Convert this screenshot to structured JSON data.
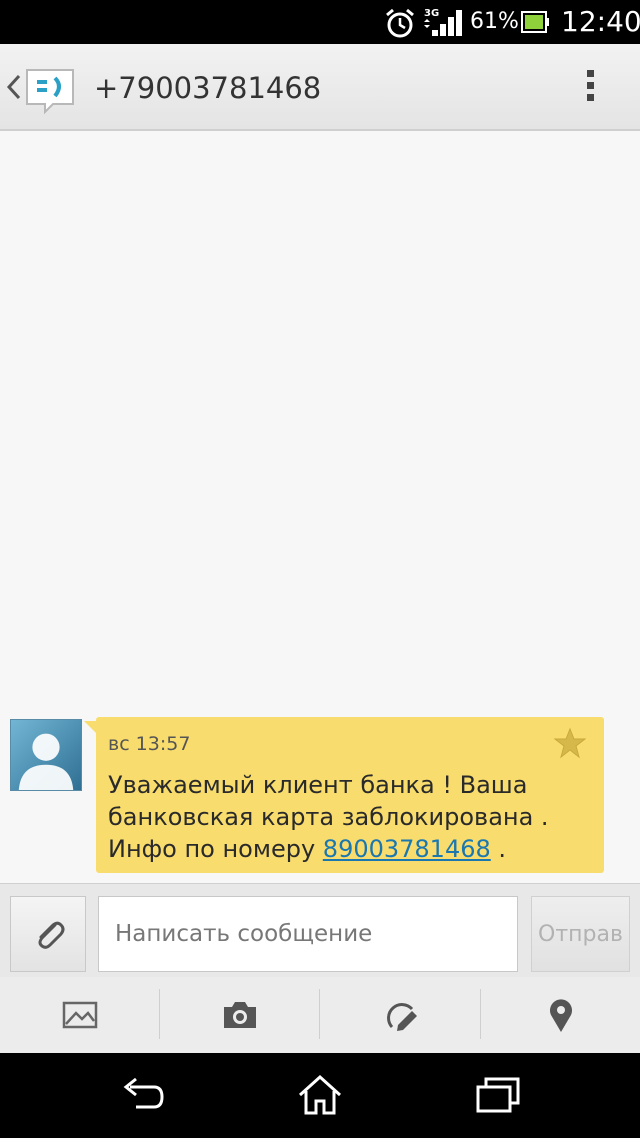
{
  "status_bar": {
    "network_type": "3G",
    "battery_percent": "61%",
    "time": "12:40",
    "icons": [
      "alarm-icon",
      "signal-icon",
      "battery-icon"
    ]
  },
  "action_bar": {
    "title": "+79003781468",
    "icons": [
      "back-chevron-icon",
      "messaging-app-icon",
      "overflow-menu-icon"
    ]
  },
  "conversation": {
    "messages": [
      {
        "time": "вс 13:57",
        "text_before": "Уважаемый клиент банка ! Ваша банковская карта заблокирована . Инфо по номеру ",
        "link": "89003781468",
        "text_after": " .",
        "starred": false
      }
    ]
  },
  "compose": {
    "placeholder": "Написать сообщение",
    "value": "",
    "send_label": "Отправ"
  },
  "toolbar": {
    "items": [
      "gallery-icon",
      "camera-icon",
      "sketch-icon",
      "location-icon"
    ]
  },
  "nav_bar": {
    "items": [
      "back-icon",
      "home-icon",
      "recent-apps-icon"
    ]
  },
  "colors": {
    "bubble": "#f8dc6d",
    "link": "#1a77b0",
    "accent": "#2aa0c6"
  }
}
